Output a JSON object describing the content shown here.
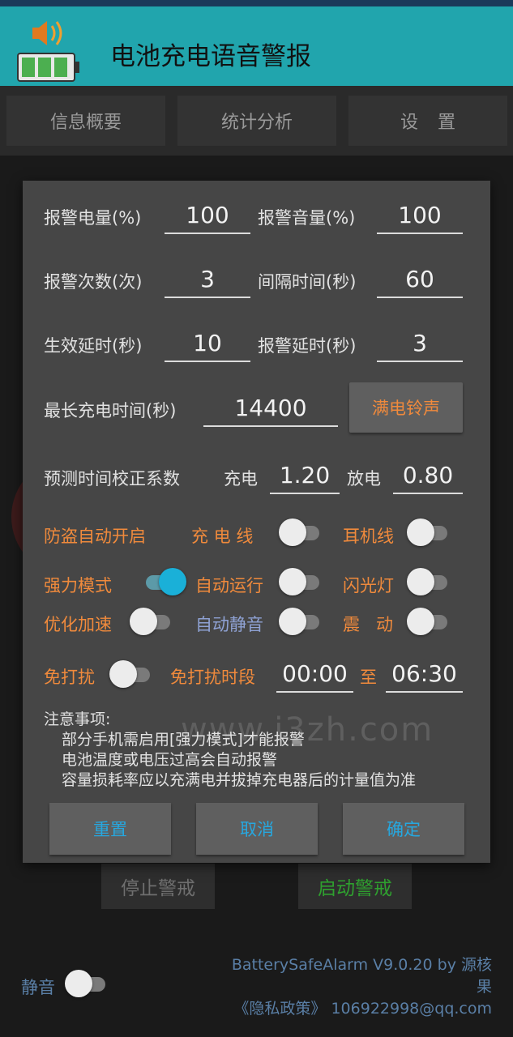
{
  "app": {
    "title": "电池充电语音警报",
    "icon": "speaker-battery-icon"
  },
  "tabs": [
    {
      "label": "信息概要"
    },
    {
      "label": "统计分析"
    },
    {
      "label": "设置"
    }
  ],
  "background": {
    "stop_label": "停止警戒",
    "start_label": "启动警戒",
    "mute_label": "静音",
    "version_line1": "BatterySafeAlarm V9.0.20 by 源核",
    "version_line2": "果",
    "privacy_line": "《隐私政策》 106922998@qq.com"
  },
  "dialog": {
    "alarm_level_label": "报警电量(%)",
    "alarm_level_value": "100",
    "alarm_volume_label": "报警音量(%)",
    "alarm_volume_value": "100",
    "alarm_count_label": "报警次数(次)",
    "alarm_count_value": "3",
    "interval_label": "间隔时间(秒)",
    "interval_value": "60",
    "effect_delay_label": "生效延时(秒)",
    "effect_delay_value": "10",
    "alarm_delay_label": "报警延时(秒)",
    "alarm_delay_value": "3",
    "max_charge_label": "最长充电时间(秒)",
    "max_charge_value": "14400",
    "full_ringtone_label": "满电铃声",
    "predict_label": "预测时间校正系数",
    "charge_label": "充电",
    "charge_value": "1.20",
    "discharge_label": "放电",
    "discharge_value": "0.80",
    "antitheft_label": "防盗自动开启",
    "charge_cable_label": "充 电 线",
    "earphone_label": "耳机线",
    "strong_mode_label": "强力模式",
    "auto_run_label": "自动运行",
    "flashlight_label": "闪光灯",
    "optimize_label": "优化加速",
    "auto_mute_label": "自动静音",
    "vibrate_label": "震   动",
    "dnd_label": "免打扰",
    "dnd_period_label": "免打扰时段",
    "dnd_start": "00:00",
    "dnd_to": "至",
    "dnd_end": "06:30",
    "notes_title": "注意事项:",
    "notes": [
      "部分手机需启用[强力模式]才能报警",
      "电池温度或电压过高会自动报警",
      "容量损耗率应以充满电并拔掉充电器后的计量值为准"
    ],
    "reset_label": "重置",
    "cancel_label": "取消",
    "confirm_label": "确定",
    "toggles": {
      "charge_cable": false,
      "earphone": false,
      "strong_mode": true,
      "auto_run": false,
      "flashlight": false,
      "optimize": false,
      "auto_mute": false,
      "vibrate": false,
      "dnd": false,
      "mute": false
    }
  },
  "watermark": "www.i3zh.com",
  "colors": {
    "appbar": "#21a5ad",
    "accent_orange": "#f08a3c",
    "accent_blue": "#26a8e0",
    "toggle_on": "#1ab0d8",
    "dialog_bg": "#464646"
  }
}
